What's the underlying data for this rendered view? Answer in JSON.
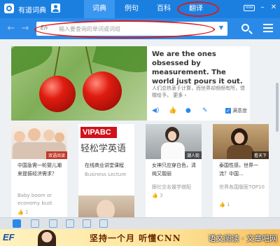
{
  "app": {
    "title": "有道词典"
  },
  "tabs": [
    {
      "label": "词典",
      "active": true
    },
    {
      "label": "例句",
      "active": false
    },
    {
      "label": "百科",
      "active": false
    },
    {
      "label": "翻译",
      "active": false
    }
  ],
  "window": {
    "skin_label": "mini",
    "minimize": "–",
    "close": "✕"
  },
  "search": {
    "lang_label": "En",
    "placeholder": "输入要查询的单词或词组",
    "dropdown": "▼"
  },
  "hero": {
    "headline": "We are the ones obsessed by measurement. The world just pours it out.",
    "subtext": "人们总热衷于计算，而世界却频频有所，馈赠给予。",
    "more": "更多 ›",
    "favorite_label": "满意度"
  },
  "cards": [
    {
      "badge": "双语阅读",
      "title": "中国急需一轮婴儿潮来提振经济需求？",
      "sub": "Baby boom or economy bust",
      "likes": "👍 1"
    },
    {
      "image_text": "VIPABC",
      "image_sub": "轻松学英语",
      "title": "在线商业讲堂课程",
      "sub": "Business Lecture",
      "likes": ""
    },
    {
      "badge": "潮人街",
      "title": "女神只应穿白色，清纯又靓丽",
      "sub": "跟社交名媛学搭配",
      "likes": "👍 3"
    },
    {
      "badge": "看天下",
      "title": "泰国性感，世界一流？中国…",
      "sub": "世界各国版医TOP10",
      "likes": "👍 1"
    }
  ],
  "ad": {
    "logo": "EF",
    "slogan": "坚持一个月 听懂CNN",
    "watermark": "语文阅读 · 文章吧网"
  },
  "colors": {
    "accent": "#1b7fe0",
    "annotation": "#e01818"
  }
}
